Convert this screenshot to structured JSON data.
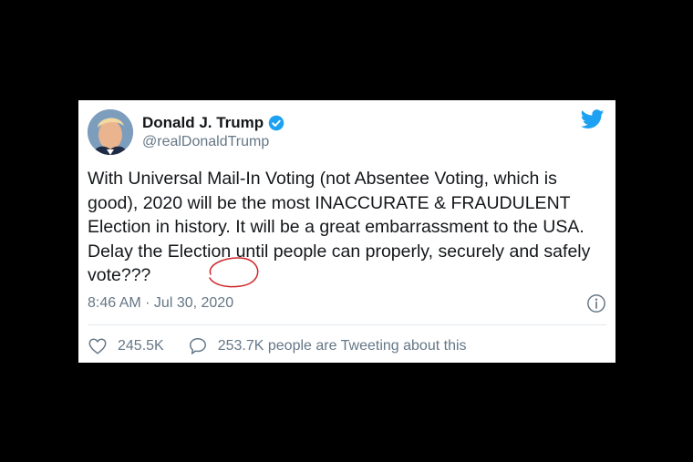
{
  "tweet": {
    "display_name": "Donald J. Trump",
    "handle": "@realDonaldTrump",
    "text": "With Universal Mail-In Voting (not Absentee Voting, which is good), 2020 will be the most INACCURATE & FRAUDULENT Election in history. It will be a great embarrassment to the USA. Delay the Election until people can properly, securely and safely vote???",
    "timestamp": "8:46 AM · Jul 30, 2020",
    "likes": "245.5K",
    "conversation": "253.7K people are Tweeting about this"
  },
  "icons": {
    "verified": "verified-badge-icon",
    "logo": "twitter-bird-icon",
    "info": "info-icon",
    "like": "heart-icon",
    "reply": "speech-bubble-icon"
  },
  "colors": {
    "brand": "#1da1f2",
    "text": "#14171a",
    "secondary": "#657786",
    "annotation": "#d0262a"
  }
}
